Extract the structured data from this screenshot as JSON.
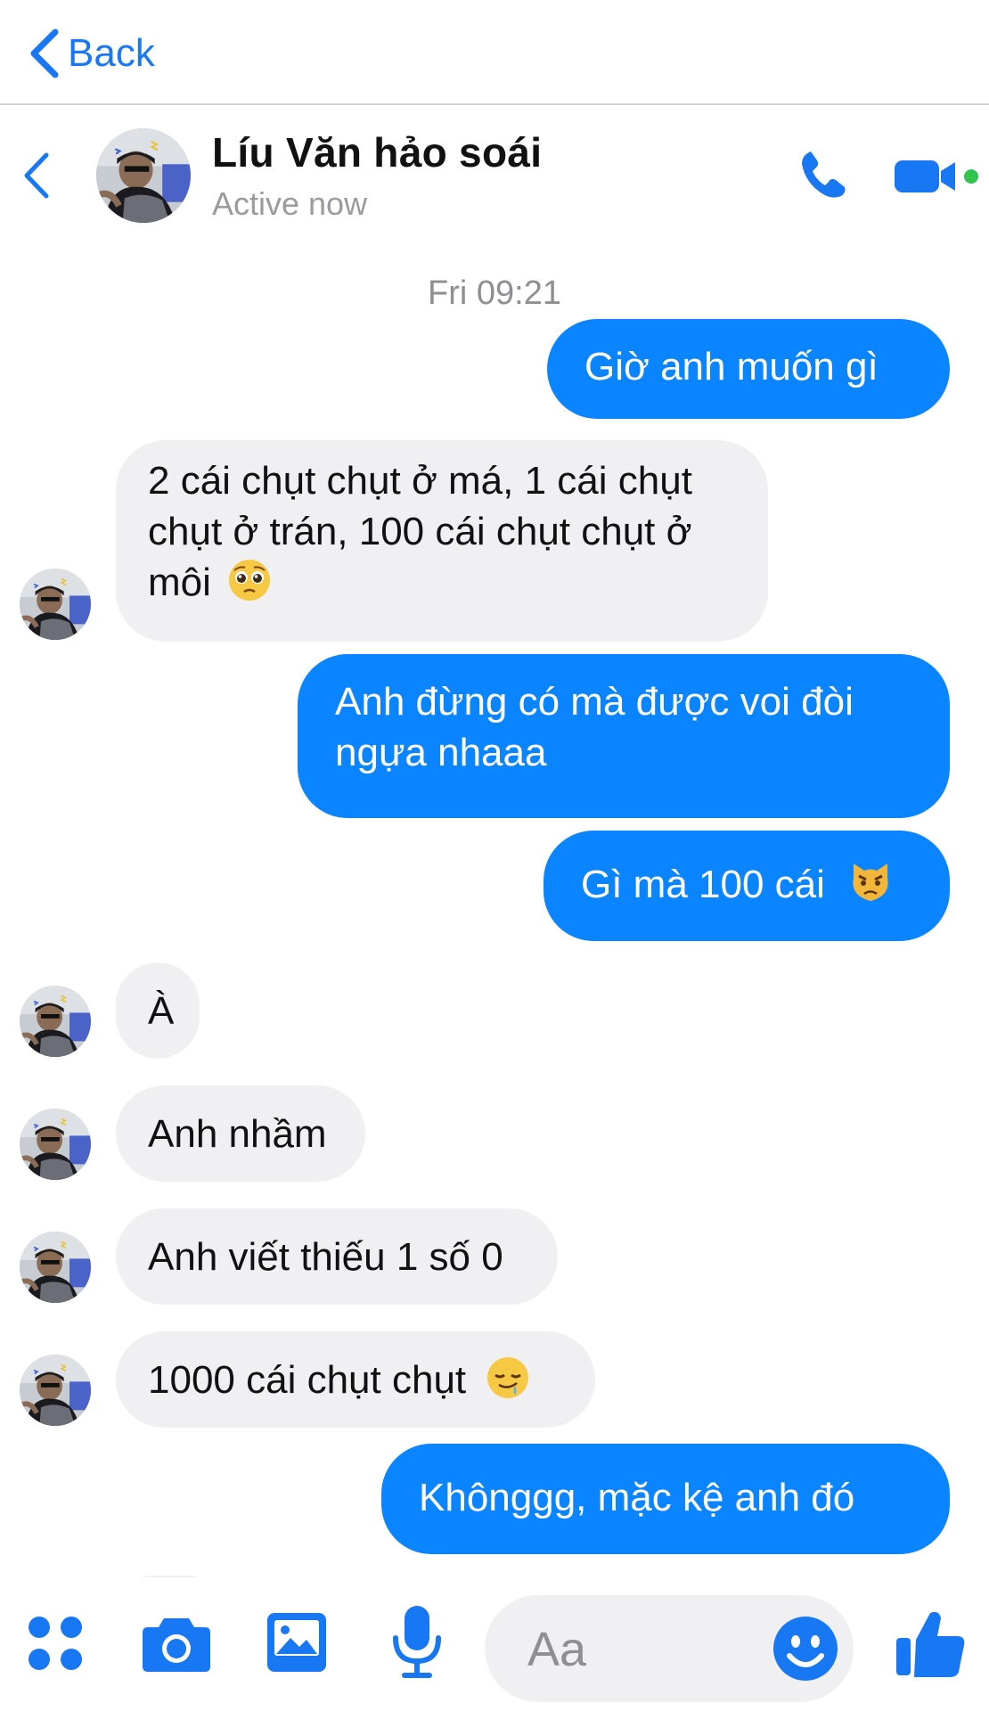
{
  "top_nav": {
    "back_label": "Back"
  },
  "header": {
    "name": "Líu Văn hảo soái",
    "status": "Active now"
  },
  "timestamp": "Fri 09:21",
  "messages": [
    {
      "from": "me",
      "text": "Giờ anh muốn gì"
    },
    {
      "from": "them",
      "text": "2 cái chụt chụt ở má, 1 cái chụt",
      "text2": "chụt ở trán, 100 cái chụt chụt ở",
      "text3": "môi",
      "emoji": "pleading-face-emoji"
    },
    {
      "from": "me",
      "text": "Anh đừng có mà được voi đòi",
      "text2": "ngựa nhaaa"
    },
    {
      "from": "me",
      "text": "Gì mà 100 cái",
      "emoji": "pouting-cat-emoji"
    },
    {
      "from": "them",
      "text": "À"
    },
    {
      "from": "them",
      "text": "Anh nhầm"
    },
    {
      "from": "them",
      "text": "Anh viết thiếu 1 số 0"
    },
    {
      "from": "them",
      "text": "1000 cái chụt chụt",
      "emoji": "drooling-face-emoji"
    },
    {
      "from": "me",
      "text": "Khônggg, mặc kệ anh đó"
    }
  ],
  "composer": {
    "placeholder": "Aa",
    "icons": [
      "more-apps-icon",
      "camera-icon",
      "gallery-icon",
      "microphone-icon",
      "emoji-icon",
      "like-icon"
    ]
  },
  "colors": {
    "accent": "#1877f2",
    "outgoing_bubble": "#0a84ff",
    "incoming_bubble": "#f0f0f2",
    "active_dot": "#31c44f"
  }
}
